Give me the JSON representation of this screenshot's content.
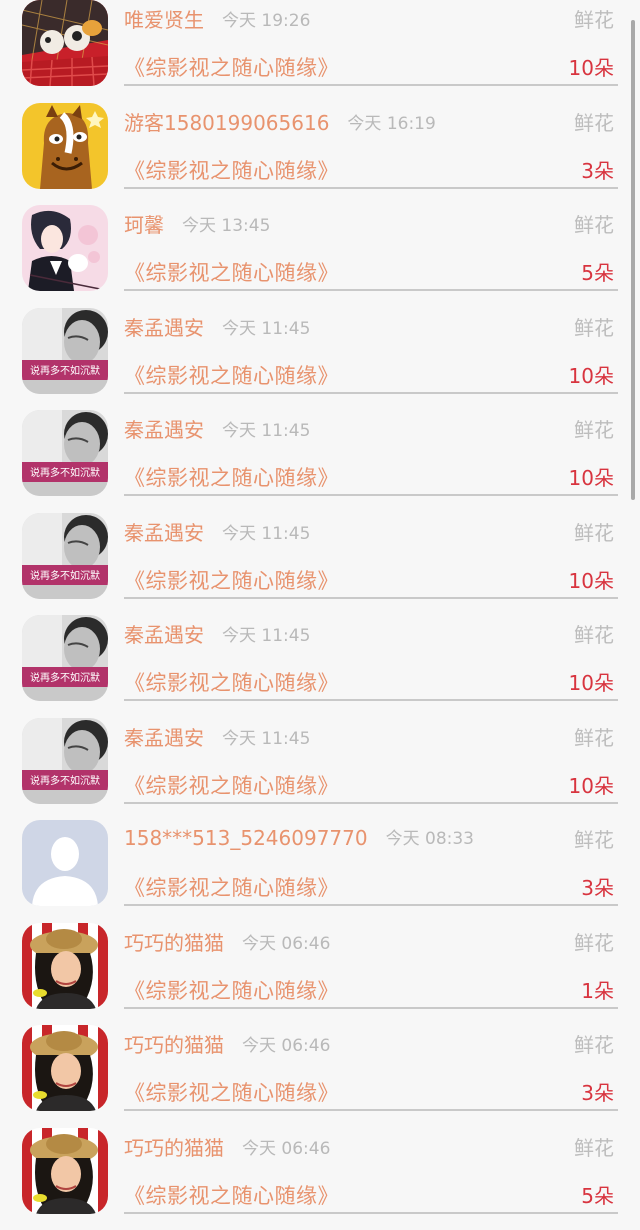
{
  "gift_label": "鲜花",
  "rows": [
    {
      "name": "唯爱贤生",
      "time": "今天 19:26",
      "book": "《综影视之随心随缘》",
      "count": "10朵",
      "avatar": "avatar-cartoon-dogs"
    },
    {
      "name": "游客1580199065616",
      "time": "今天 16:19",
      "book": "《综影视之随心随缘》",
      "count": "3朵",
      "avatar": "avatar-horse"
    },
    {
      "name": "珂馨",
      "time": "今天 13:45",
      "book": "《综影视之随心随缘》",
      "count": "5朵",
      "avatar": "avatar-anime"
    },
    {
      "name": "秦孟遇安",
      "time": "今天 11:45",
      "book": "《综影视之随心随缘》",
      "count": "10朵",
      "avatar": "avatar-bw",
      "caption": "说再多不如沉默"
    },
    {
      "name": "秦孟遇安",
      "time": "今天 11:45",
      "book": "《综影视之随心随缘》",
      "count": "10朵",
      "avatar": "avatar-bw",
      "caption": "说再多不如沉默"
    },
    {
      "name": "秦孟遇安",
      "time": "今天 11:45",
      "book": "《综影视之随心随缘》",
      "count": "10朵",
      "avatar": "avatar-bw",
      "caption": "说再多不如沉默"
    },
    {
      "name": "秦孟遇安",
      "time": "今天 11:45",
      "book": "《综影视之随心随缘》",
      "count": "10朵",
      "avatar": "avatar-bw",
      "caption": "说再多不如沉默"
    },
    {
      "name": "秦孟遇安",
      "time": "今天 11:45",
      "book": "《综影视之随心随缘》",
      "count": "10朵",
      "avatar": "avatar-bw",
      "caption": "说再多不如沉默"
    },
    {
      "name": "158***513_5246097770",
      "time": "今天 08:33",
      "book": "《综影视之随心随缘》",
      "count": "3朵",
      "avatar": "avatar-default"
    },
    {
      "name": "巧巧的猫猫",
      "time": "今天 06:46",
      "book": "《综影视之随心随缘》",
      "count": "1朵",
      "avatar": "avatar-girl-hat"
    },
    {
      "name": "巧巧的猫猫",
      "time": "今天 06:46",
      "book": "《综影视之随心随缘》",
      "count": "3朵",
      "avatar": "avatar-girl-hat"
    },
    {
      "name": "巧巧的猫猫",
      "time": "今天 06:46",
      "book": "《综影视之随心随缘》",
      "count": "5朵",
      "avatar": "avatar-girl-hat"
    }
  ]
}
